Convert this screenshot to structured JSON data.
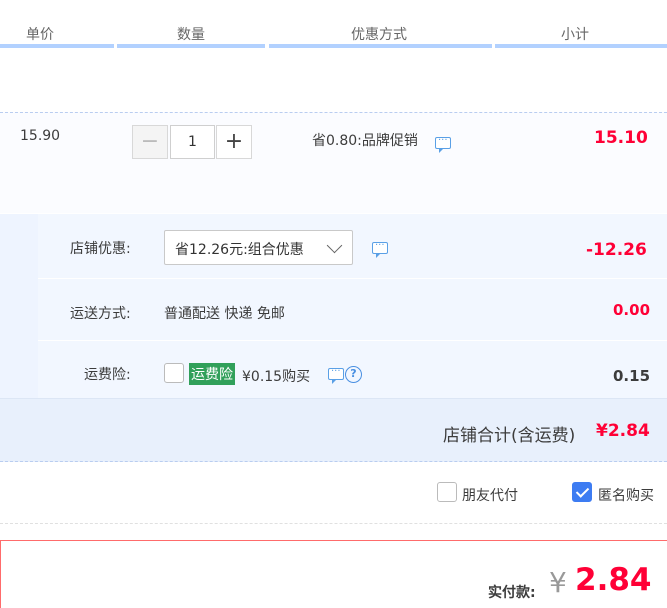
{
  "header": {
    "col_price": "单价",
    "col_qty": "数量",
    "col_promo": "优惠方式",
    "col_subtotal": "小计"
  },
  "item": {
    "unit_price": "15.90",
    "minus": "−",
    "quantity": "1",
    "plus": "+",
    "promo": "省0.80:品牌促销",
    "subtotal": "15.10"
  },
  "shop": {
    "discount_label": "店铺优惠:",
    "discount_selected": "省12.26元:组合优惠",
    "discount_amount": "-12.26",
    "shipping_label": "运送方式:",
    "shipping_value": "普通配送 快递 免邮",
    "shipping_amount": "0.00",
    "insurance_label": "运费险:",
    "insurance_tag": "运费险",
    "insurance_price": "¥0.15购买",
    "insurance_amount": "0.15",
    "help_glyph": "?"
  },
  "subtotal": {
    "label": "店铺合计(含运费)",
    "amount": "¥2.84"
  },
  "options": {
    "friend_pay": "朋友代付",
    "anonymous": "匿名购买"
  },
  "payment": {
    "label": "实付款:",
    "currency": "¥",
    "amount": "2.84"
  },
  "colors": {
    "accent_red": "#ff0036",
    "header_line": "#b2d1ff",
    "checkbox_blue": "#3d7cf2",
    "tag_green": "#31a05a"
  }
}
